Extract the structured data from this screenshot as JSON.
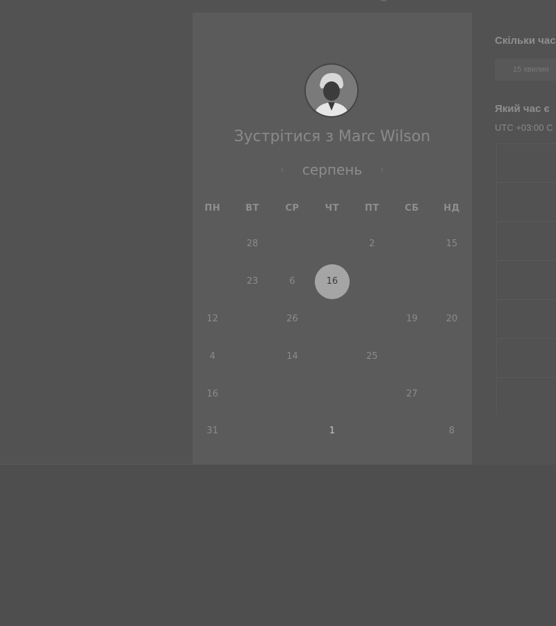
{
  "meeting": {
    "title": "Зустрітися з Marc Wilson"
  },
  "calendar": {
    "month": "серпень",
    "prev_arrow": "‹",
    "next_arrow": "›",
    "weekdays": [
      "ПН",
      "ВТ",
      "СР",
      "ЧТ",
      "ПТ",
      "СБ",
      "НД"
    ],
    "weeks": [
      [
        "",
        "28",
        "",
        "",
        "2",
        "",
        "15"
      ],
      [
        "",
        "23",
        "6",
        "16",
        "",
        "",
        ""
      ],
      [
        "12",
        "",
        "26",
        "",
        "",
        "19",
        "20"
      ],
      [
        "4",
        "",
        "14",
        "",
        "25",
        "",
        ""
      ],
      [
        "16",
        "",
        "",
        "",
        "",
        "27",
        ""
      ],
      [
        "31",
        "",
        "",
        "1",
        "",
        "",
        "8"
      ]
    ],
    "selected": "16"
  },
  "scheduler": {
    "duration_heading": "Скільки час",
    "duration_option": "15 хвилин",
    "time_heading": "Який час є",
    "timezone": "UTC +03:00 C"
  },
  "icons": {
    "avatar": "person-avatar-icon",
    "prev": "chevron-left-icon",
    "next": "chevron-right-icon"
  }
}
